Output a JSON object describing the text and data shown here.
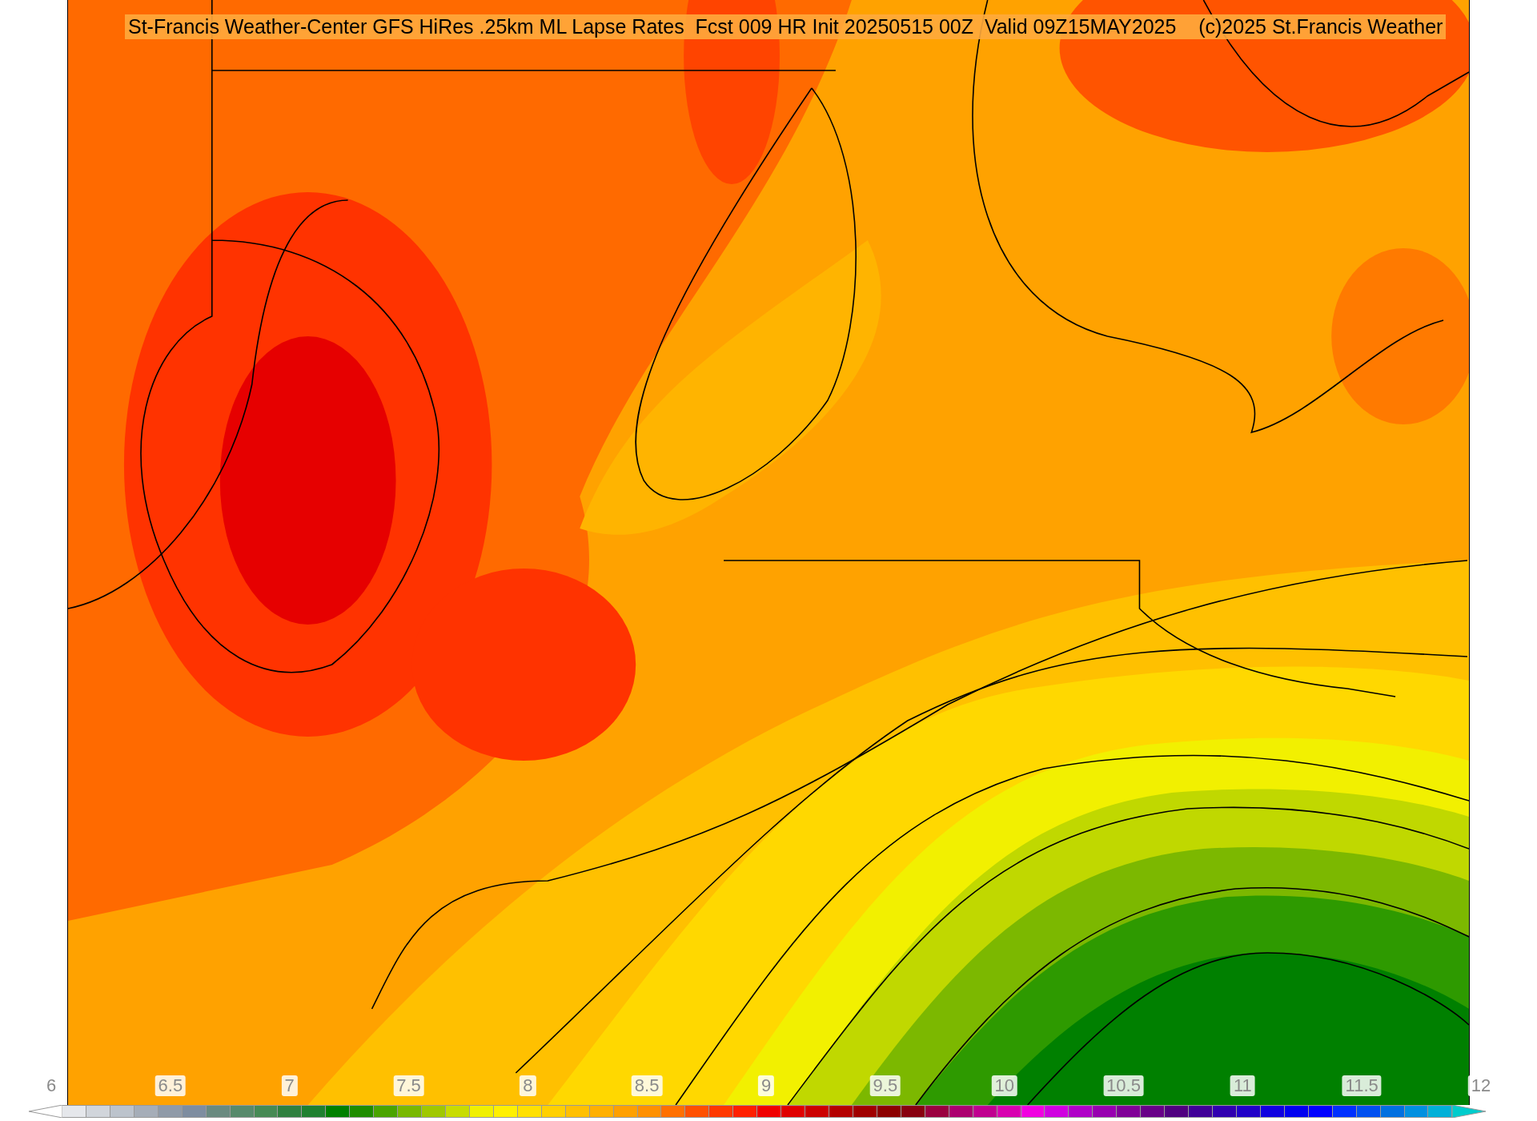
{
  "title": "St-Francis Weather-Center GFS HiRes .25km ML Lapse Rates  Fcst 009 HR Init 20250515 00Z  Valid 09Z15MAY2025    (c)2025 St.Francis Weather",
  "colorbar": {
    "tick_labels": [
      "6",
      "6.5",
      "7",
      "7.5",
      "8",
      "8.5",
      "9",
      "9.5",
      "10",
      "10.5",
      "11",
      "11.5",
      "12"
    ],
    "swatches": [
      {
        "color": "#e5e7eb"
      },
      {
        "color": "#d1d5db"
      },
      {
        "color": "#bcc3cc"
      },
      {
        "color": "#a5adb8"
      },
      {
        "color": "#8f9aa8"
      },
      {
        "color": "#7e8da0"
      },
      {
        "color": "#6a8a80"
      },
      {
        "color": "#578a6c"
      },
      {
        "color": "#468a55"
      },
      {
        "color": "#2f8040"
      },
      {
        "color": "#1e8030"
      },
      {
        "color": "#008000"
      },
      {
        "color": "#1e8c00"
      },
      {
        "color": "#4aa400"
      },
      {
        "color": "#78b800"
      },
      {
        "color": "#a0c800"
      },
      {
        "color": "#c8dc00"
      },
      {
        "color": "#f0f000"
      },
      {
        "color": "#fff000"
      },
      {
        "color": "#ffe000"
      },
      {
        "color": "#ffd000"
      },
      {
        "color": "#ffc000"
      },
      {
        "color": "#ffb000"
      },
      {
        "color": "#ffa000"
      },
      {
        "color": "#ff9000"
      },
      {
        "color": "#ff7000"
      },
      {
        "color": "#ff5000"
      },
      {
        "color": "#ff3800"
      },
      {
        "color": "#ff2000"
      },
      {
        "color": "#f00000"
      },
      {
        "color": "#e00000"
      },
      {
        "color": "#cc0000"
      },
      {
        "color": "#b40000"
      },
      {
        "color": "#a00000"
      },
      {
        "color": "#8c0000"
      },
      {
        "color": "#880010"
      },
      {
        "color": "#9a0040"
      },
      {
        "color": "#ac0070"
      },
      {
        "color": "#c00090"
      },
      {
        "color": "#d800b0"
      },
      {
        "color": "#f000e0"
      },
      {
        "color": "#d000e0"
      },
      {
        "color": "#b000c8"
      },
      {
        "color": "#9800b0"
      },
      {
        "color": "#800098"
      },
      {
        "color": "#680088"
      },
      {
        "color": "#500080"
      },
      {
        "color": "#400098"
      },
      {
        "color": "#3000b0"
      },
      {
        "color": "#2000c8"
      },
      {
        "color": "#1000e0"
      },
      {
        "color": "#0000f0"
      },
      {
        "color": "#0000ff"
      },
      {
        "color": "#0030ff"
      },
      {
        "color": "#0050f0"
      },
      {
        "color": "#0070e0"
      },
      {
        "color": "#0090e0"
      },
      {
        "color": "#00b0d8"
      }
    ]
  }
}
